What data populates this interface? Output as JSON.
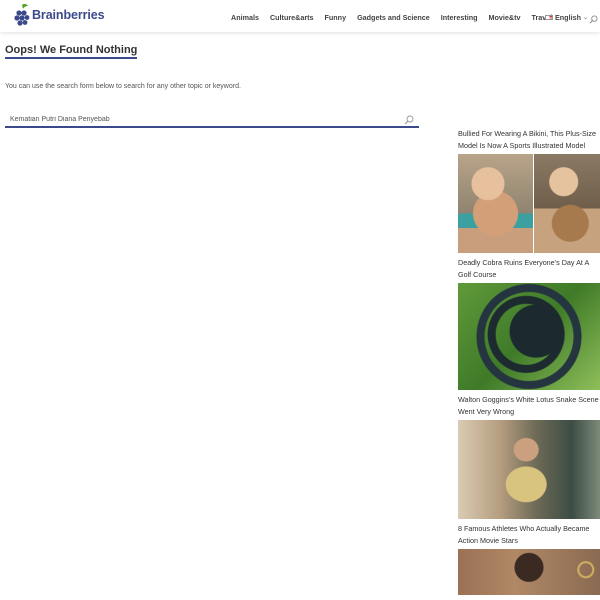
{
  "header": {
    "logo_text": "Brainberries",
    "nav": [
      "Animals",
      "Culture&arts",
      "Funny",
      "Gadgets and Science",
      "Interesting",
      "Movie&tv",
      "Travel"
    ],
    "language": "English"
  },
  "main": {
    "title": "Oops! We Found Nothing",
    "description": "You can use the search form below to search for any other topic or keyword.",
    "search_value": "Kematian Putri Diana Penyebab"
  },
  "sidebar": {
    "articles": [
      {
        "title": "Bullied For Wearing A Bikini, This Plus-Size Model Is Now A Sports Illustrated Model"
      },
      {
        "title": "Deadly Cobra Ruins Everyone’s Day At A Golf Course"
      },
      {
        "title": "Walton Goggins’s White Lotus Snake Scene Went Very Wrong"
      },
      {
        "title": "8 Famous Athletes Who Actually Became Action Movie Stars"
      }
    ]
  },
  "colors": {
    "brand": "#3a4a8a",
    "logo_leaf": "#5aa02c"
  },
  "icons": [
    "brainberries-logo",
    "us-flag-icon",
    "chevron-down-icon",
    "search-icon"
  ]
}
